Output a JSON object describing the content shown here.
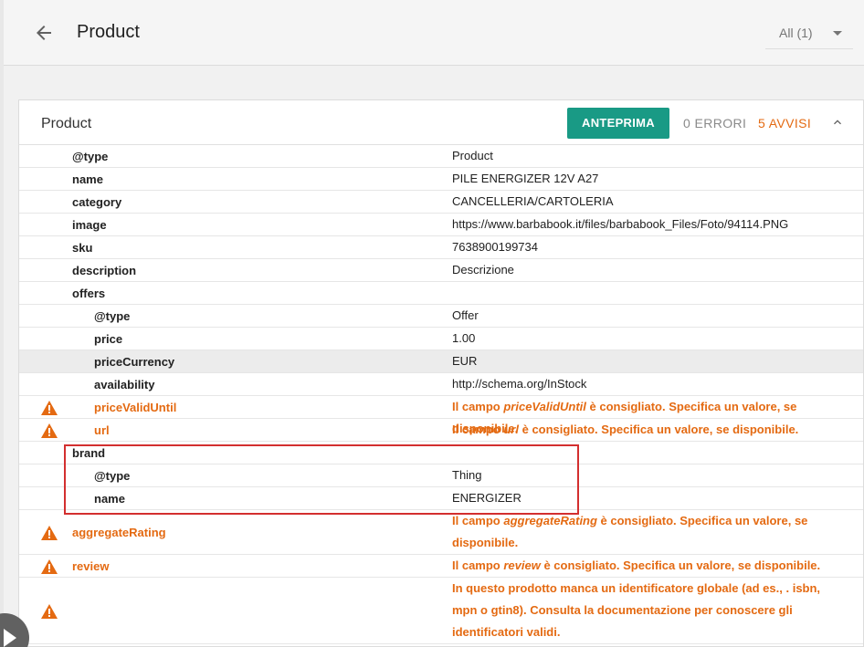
{
  "header": {
    "title": "Product",
    "filter_label": "All (1)"
  },
  "card": {
    "title": "Product",
    "preview_label": "ANTEPRIMA",
    "errors_label": "0 ERRORI",
    "warnings_label": "5 AVVISI"
  },
  "colors": {
    "accent": "#199a85",
    "warning": "#e46a12",
    "highlight_box": "#d32f2f"
  },
  "rows": [
    {
      "prop": "@type",
      "value": "Product"
    },
    {
      "prop": "name",
      "value": "PILE ENERGIZER 12V A27"
    },
    {
      "prop": "category",
      "value": "CANCELLERIA/CARTOLERIA"
    },
    {
      "prop": "image",
      "value": "https://www.barbabook.it/files/barbabook_Files/Foto/94114.PNG"
    },
    {
      "prop": "sku",
      "value": "7638900199734"
    },
    {
      "prop": "description",
      "value": "Descrizione"
    },
    {
      "prop": "offers",
      "value": ""
    },
    {
      "prop": "@type",
      "value": "Offer"
    },
    {
      "prop": "price",
      "value": "1.00"
    },
    {
      "prop": "priceCurrency",
      "value": "EUR"
    },
    {
      "prop": "availability",
      "value": "http://schema.org/InStock"
    },
    {
      "prop": "priceValidUntil",
      "msg_pre": "Il campo ",
      "msg_field": "priceValidUntil",
      "msg_post": " è consigliato. Specifica un valore, se disponibile."
    },
    {
      "prop": "url",
      "msg_pre": "Il campo ",
      "msg_field": "url",
      "msg_post": " è consigliato. Specifica un valore, se disponibile."
    },
    {
      "prop": "brand",
      "value": ""
    },
    {
      "prop": "@type",
      "value": "Thing"
    },
    {
      "prop": "name",
      "value": "ENERGIZER"
    },
    {
      "prop": "aggregateRating",
      "msg_pre": "Il campo ",
      "msg_field": "aggregateRating",
      "msg_post": " è consigliato. Specifica un valore, se disponibile."
    },
    {
      "prop": "review",
      "msg_pre": "Il campo ",
      "msg_field": "review",
      "msg_post": " è consigliato. Specifica un valore, se disponibile."
    },
    {
      "prop": "",
      "value": "In questo prodotto manca un identificatore globale (ad es., . isbn, mpn o gtin8). Consulta la documentazione per conoscere gli identificatori validi."
    }
  ],
  "icons": {
    "back": "arrow-left-icon",
    "dropdown": "caret-down-icon",
    "collapse": "chevron-up-icon",
    "warning": "warning-triangle-icon",
    "fab": "play-icon"
  }
}
